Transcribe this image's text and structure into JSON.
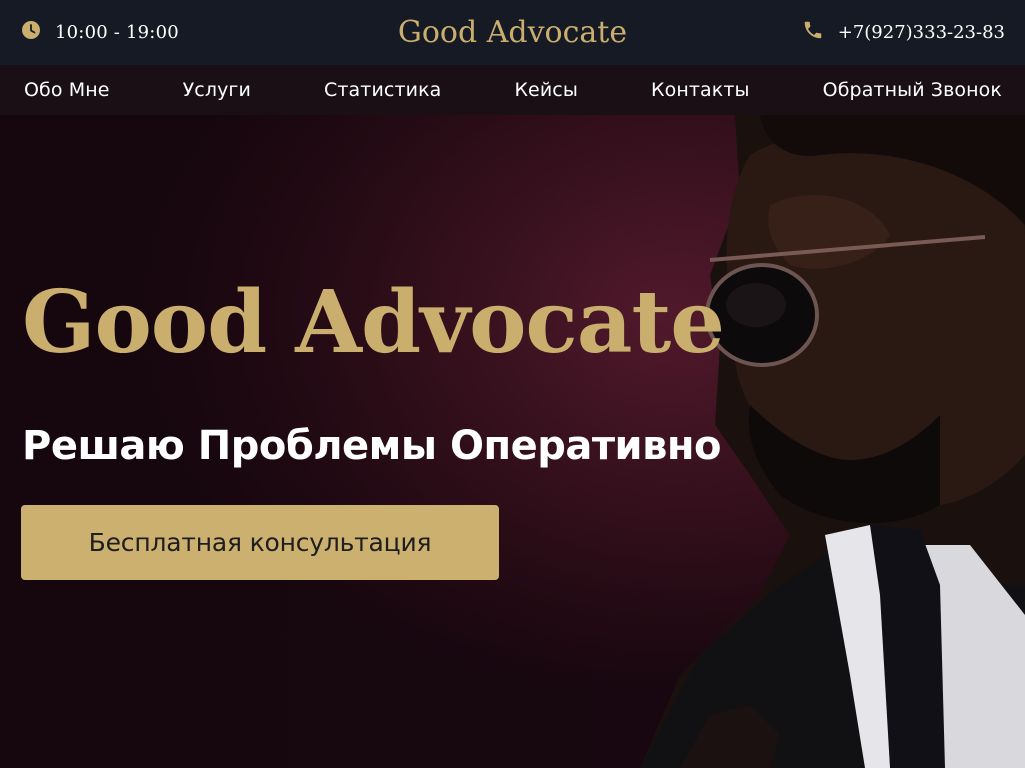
{
  "header": {
    "hours": "10:00 - 19:00",
    "brand": "Good Advocate",
    "phone": "+7(927)333-23-83",
    "hours_icon": "clock-icon",
    "phone_icon": "phone-icon",
    "accent_color": "#caae6e",
    "background_color": "#161a25"
  },
  "nav": {
    "items": [
      {
        "label": "Обо Мне"
      },
      {
        "label": "Услуги"
      },
      {
        "label": "Статистика"
      },
      {
        "label": "Кейсы"
      },
      {
        "label": "Контакты"
      },
      {
        "label": "Обратный Звонок"
      }
    ]
  },
  "hero": {
    "title": "Good Advocate",
    "subtitle": "Решаю Проблемы Оперативно",
    "cta_label": "Бесплатная консультация",
    "cta_color": "#ccb06f",
    "image": "man-in-sunglasses-photo"
  }
}
